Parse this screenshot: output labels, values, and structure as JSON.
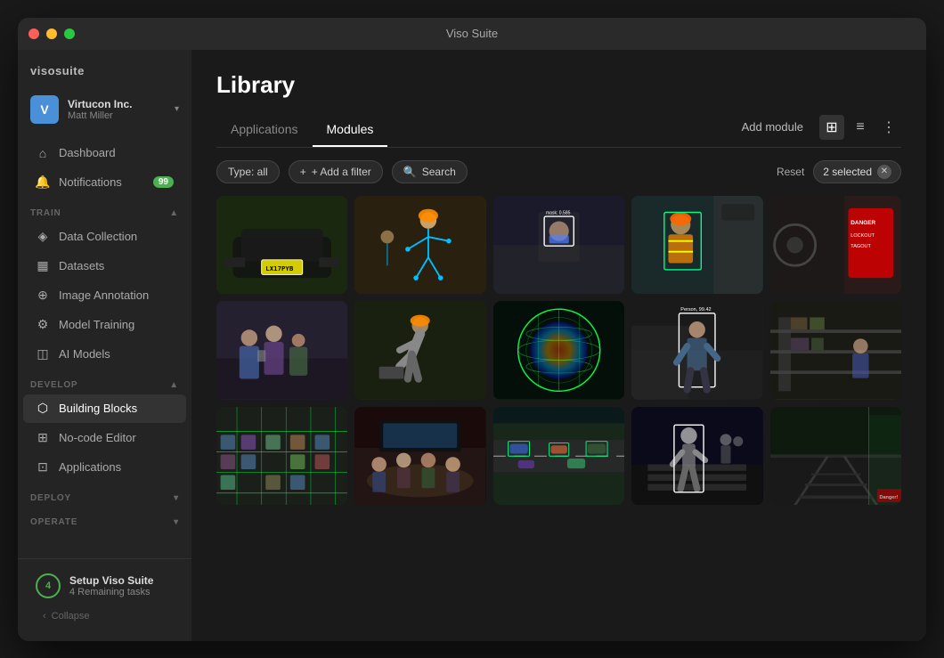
{
  "window": {
    "title": "Viso Suite"
  },
  "sidebar": {
    "brand": "visosuite",
    "account": {
      "company": "Virtucon Inc.",
      "user": "Matt Miller",
      "avatar_letter": "V"
    },
    "nav": [
      {
        "id": "dashboard",
        "label": "Dashboard",
        "icon": "house"
      },
      {
        "id": "notifications",
        "label": "Notifications",
        "icon": "bell",
        "badge": "99"
      }
    ],
    "sections": [
      {
        "label": "TRAIN",
        "items": [
          {
            "id": "data-collection",
            "label": "Data Collection",
            "icon": "database"
          },
          {
            "id": "datasets",
            "label": "Datasets",
            "icon": "table"
          },
          {
            "id": "image-annotation",
            "label": "Image Annotation",
            "icon": "tag"
          },
          {
            "id": "model-training",
            "label": "Model Training",
            "icon": "cpu"
          },
          {
            "id": "ai-models",
            "label": "AI Models",
            "icon": "layers"
          }
        ]
      },
      {
        "label": "DEVELOP",
        "items": [
          {
            "id": "building-blocks",
            "label": "Building Blocks",
            "icon": "cube",
            "active": true
          },
          {
            "id": "no-code-editor",
            "label": "No-code Editor",
            "icon": "code"
          },
          {
            "id": "applications",
            "label": "Applications",
            "icon": "grid"
          }
        ]
      },
      {
        "label": "DEPLOY",
        "items": []
      },
      {
        "label": "OPERATE",
        "items": []
      }
    ],
    "setup": {
      "count": "4",
      "title": "Setup Viso Suite",
      "subtitle": "4 Remaining tasks"
    },
    "collapse_label": "Collapse"
  },
  "main": {
    "page_title": "Library",
    "tabs": [
      {
        "id": "applications",
        "label": "Applications",
        "active": false
      },
      {
        "id": "modules",
        "label": "Modules",
        "active": true
      }
    ],
    "actions": {
      "add_module": "Add module"
    },
    "filters": {
      "type_label": "Type: all",
      "add_filter": "+ Add a filter",
      "search": "Search",
      "reset": "Reset",
      "selected": "2 selected"
    },
    "gallery_items": [
      {
        "id": 1,
        "theme": "car",
        "has_box": false,
        "label": "LX17PYB",
        "type": "license-plate"
      },
      {
        "id": 2,
        "theme": "worker1",
        "has_box": false,
        "label": "",
        "type": "pose"
      },
      {
        "id": 3,
        "theme": "face",
        "has_box": true,
        "label": "mask: 0.585",
        "type": "face-detection"
      },
      {
        "id": 4,
        "theme": "safety",
        "has_box": false,
        "label": "",
        "type": "safety-vest"
      },
      {
        "id": 5,
        "theme": "danger",
        "has_box": false,
        "label": "DANGER LOCKOUT",
        "type": "warning-sign"
      },
      {
        "id": 6,
        "theme": "people",
        "has_box": false,
        "label": "",
        "type": "crowd"
      },
      {
        "id": 7,
        "theme": "worker2",
        "has_box": false,
        "label": "",
        "type": "worker"
      },
      {
        "id": 8,
        "theme": "globe",
        "has_box": false,
        "label": "",
        "type": "thermal"
      },
      {
        "id": 9,
        "theme": "person",
        "has_box": true,
        "label": "Person, 99.42",
        "type": "person-detection"
      },
      {
        "id": 10,
        "theme": "warehouse",
        "has_box": false,
        "label": "",
        "type": "warehouse"
      },
      {
        "id": 11,
        "theme": "parking",
        "has_box": false,
        "label": "",
        "type": "parking"
      },
      {
        "id": 12,
        "theme": "meeting",
        "has_box": false,
        "label": "",
        "type": "meeting"
      },
      {
        "id": 13,
        "theme": "road",
        "has_box": false,
        "label": "",
        "type": "road"
      },
      {
        "id": 14,
        "theme": "walking",
        "has_box": false,
        "label": "",
        "type": "walking"
      },
      {
        "id": 15,
        "theme": "rail",
        "has_box": false,
        "label": "",
        "type": "rail"
      }
    ]
  }
}
